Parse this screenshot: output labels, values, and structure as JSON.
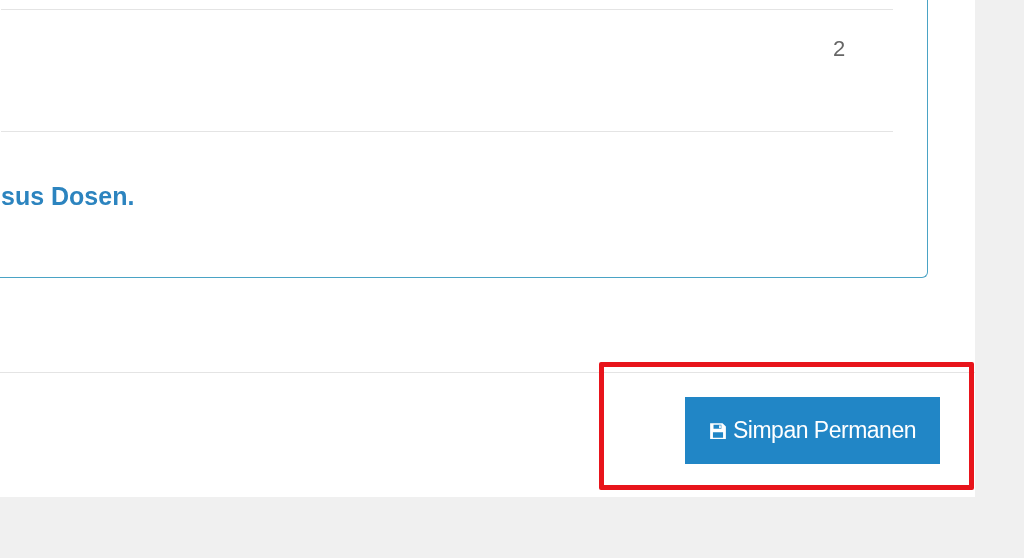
{
  "table": {
    "rows": [
      {
        "cells": [
          "2"
        ]
      }
    ]
  },
  "note": "sus Dosen.",
  "footer": {
    "button": {
      "label": "Simpan Permanen"
    },
    "highlighted": true
  }
}
